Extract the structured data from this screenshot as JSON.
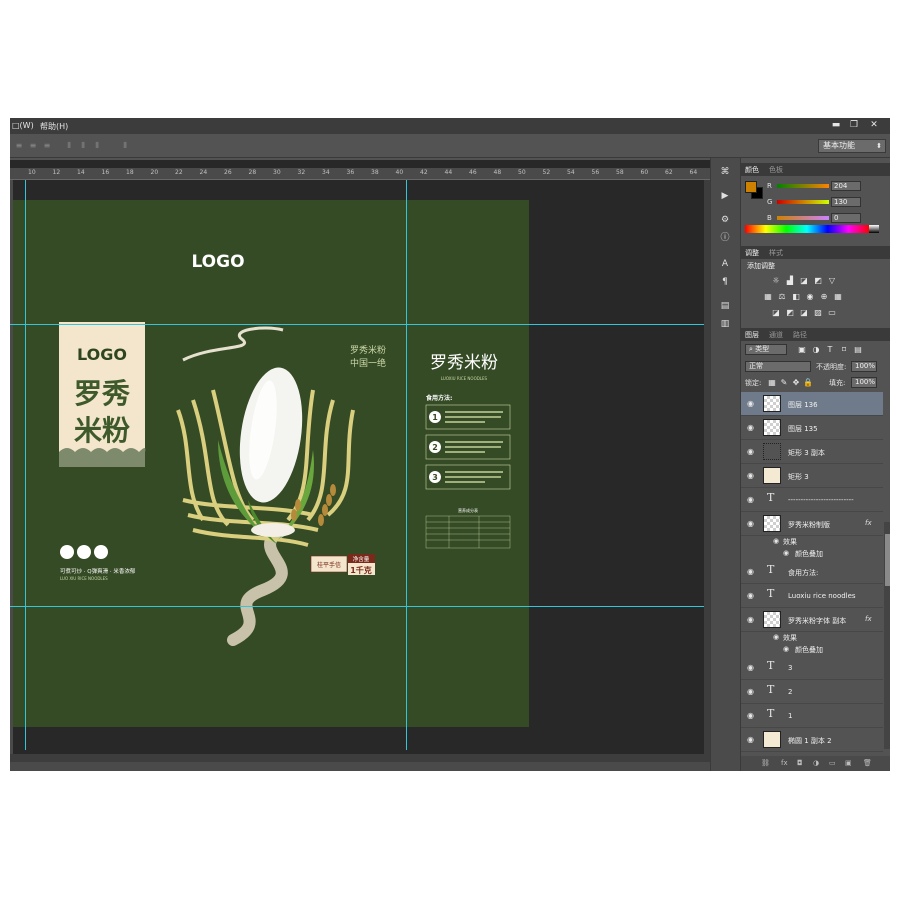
{
  "menu": {
    "window_fragment": "□(W)",
    "help": "帮助(H)"
  },
  "window_controls": {
    "minimize": "▬",
    "restore": "❐",
    "close": "✕"
  },
  "options": {
    "workspace": "基本功能"
  },
  "ruler": {
    "ticks": [
      "10",
      "12",
      "14",
      "16",
      "18",
      "20",
      "22",
      "24",
      "26",
      "28",
      "30",
      "32",
      "34",
      "36",
      "38",
      "40",
      "42",
      "44",
      "46",
      "48",
      "50",
      "52",
      "54",
      "56",
      "58",
      "60",
      "62",
      "64"
    ]
  },
  "design": {
    "logo_top": "LOGO",
    "logo_label": "LOGO",
    "brand_vertical": [
      "罗秀",
      "米粉"
    ],
    "slogan_lines": [
      "罗秀米粉",
      "中国一绝"
    ],
    "product_title": "罗秀米粉",
    "product_subtitle": "LUOXIU RICE NOODLES",
    "usage_title": "食用方法:",
    "steps": [
      {
        "num": "1",
        "text": ""
      },
      {
        "num": "2",
        "text": ""
      },
      {
        "num": "3",
        "text": ""
      }
    ],
    "nutrition_title": "营养成分表",
    "features": "可煮可炒 · Q弹爽滑 · 米香浓郁",
    "features_en": "LUO XIU RICE NOODLES",
    "stamp_text": "桂平手信",
    "net_label": "净含量",
    "net_value": "1千克"
  },
  "color_panel": {
    "tabs": [
      "颜色",
      "色板"
    ],
    "foreground": "#cc8200",
    "channels": [
      {
        "label": "R",
        "value": "204"
      },
      {
        "label": "G",
        "value": "130"
      },
      {
        "label": "B",
        "value": "0"
      }
    ]
  },
  "adjust_panel": {
    "tabs": [
      "调整",
      "样式"
    ],
    "add_label": "添加调整"
  },
  "layers_panel": {
    "tabs": [
      "图层",
      "通道",
      "路径"
    ],
    "kind": "类型",
    "blend": "正常",
    "opacity_label": "不透明度:",
    "opacity": "100%",
    "lock_label": "锁定:",
    "fill_label": "填充:",
    "fill": "100%",
    "layers": [
      {
        "name": "图层 136",
        "kind": "pixel",
        "selected": true
      },
      {
        "name": "图层 135",
        "kind": "pixel"
      },
      {
        "name": "矩形 3 副本",
        "kind": "shape"
      },
      {
        "name": "矩形 3",
        "kind": "cream"
      },
      {
        "name": "--------------------------",
        "kind": "text"
      },
      {
        "name": "罗秀米粉制版",
        "kind": "smart",
        "fx": "fx",
        "effects": [
          "效果",
          "颜色叠加"
        ]
      },
      {
        "name": "食用方法:",
        "kind": "text"
      },
      {
        "name": "Luoxiu rice noodles",
        "kind": "text"
      },
      {
        "name": "罗秀米粉字体 副本",
        "kind": "smart",
        "fx": "fx",
        "effects": [
          "效果",
          "颜色叠加"
        ]
      },
      {
        "name": "3",
        "kind": "text"
      },
      {
        "name": "2",
        "kind": "text"
      },
      {
        "name": "1",
        "kind": "text"
      },
      {
        "name": "椭圆 1 副本 2",
        "kind": "cream"
      },
      {
        "name": "椭圆 1 副本",
        "kind": "cream"
      }
    ]
  }
}
